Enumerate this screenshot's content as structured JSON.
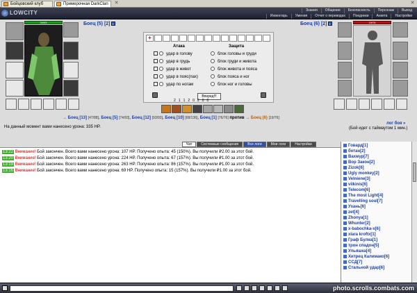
{
  "tabs": [
    {
      "label": "Бойцовский клуб"
    },
    {
      "label": "Примерочная DarkClan"
    }
  ],
  "header": {
    "logo": "LOWCITY",
    "nav_top": [
      "Знания",
      "Общение",
      "Безопасность",
      "Персонаж",
      "Выход"
    ],
    "nav_bottom": [
      "Инвентарь",
      "Умения",
      "Отчет о переводах",
      "Поединки",
      "Анкета",
      "Настройки"
    ]
  },
  "left_fighter": {
    "name": "Боец (5) [2]",
    "hp": "34/93"
  },
  "right_fighter": {
    "name": "Боец (6) [2]",
    "hp": "19/76"
  },
  "panel": {
    "attack_title": "Атака",
    "defense_title": "Защита",
    "attack": [
      "удар в голову",
      "удар в грудь",
      "удар в живот",
      "удар в пояс(пах)",
      "удар по ногам"
    ],
    "defense": [
      "блок головы и груди",
      "блок груди и живота",
      "блок живота и пояса",
      "блок пояса и ног",
      "блок ног и головы"
    ],
    "go_button": "Вперед!!!",
    "counts": [
      "2",
      "1",
      "1",
      "2",
      "0",
      "2",
      "0",
      "0"
    ]
  },
  "battle_row": {
    "team_left": [
      {
        "name": "Боец [13]",
        "hp": "[47/88]"
      },
      {
        "name": "Боец [5]",
        "hp": "[74/93]"
      },
      {
        "name": "Боец [12]",
        "hp": "[93/93]"
      },
      {
        "name": "Боец [10]",
        "hp": "[68/136]"
      },
      {
        "name": "Боец [1]",
        "hp": "[76/76]"
      }
    ],
    "vs": "против",
    "team_right": [
      {
        "name": "Боец (6)",
        "hp": "[19/76]"
      }
    ],
    "log_link": "лог боя »",
    "damage_text": "На данный момент вами нанесено урона: 335 HP.",
    "timeout": "(Бой идет с таймаутом 1 мин.)"
  },
  "chat_tabs": [
    "Чат",
    "Системные сообщения",
    "Все логи",
    "Мои логи",
    "Настройки"
  ],
  "messages": [
    {
      "time": "13:22",
      "warn": "Внимание!",
      "text": "Бой закончен. Всего вами нанесено урона: 107 HP. Получено опыта: 45 (150%). Вы получили ₽2.00 за этот бой."
    },
    {
      "time": "13:20",
      "warn": "Внимание!",
      "text": "Бой закончен. Всего вами нанесено урона: 224 HP. Получено опыта: 67 (157%). Вы получили ₽1.00 за этот бой."
    },
    {
      "time": "13:19",
      "warn": "Внимание!",
      "text": "Бой закончен. Всего вами нанесено урона: 263 HP. Получено опыта: 86 (157%). Вы получили ₽1.00 за этот бой."
    },
    {
      "time": "13:16",
      "warn": "Внимание!",
      "text": "Бой закончен. Всего вами нанесено урона: 69 HP. Получено опыта: 15 (157%). Вы получили ₽1.00 за этот бой."
    }
  ],
  "online": [
    "Говард[1]",
    "ботан[2]",
    "Вахмур[7]",
    "Вор Закон[2]",
    "Zizok[6]",
    "Ugly monkey[2]",
    "Velniene[3]",
    "vilkinis[6]",
    "Telecom[6]",
    "The most Light[4]",
    "Travelling soul[7]",
    "Ухань[6]",
    "zet[4]",
    "Zhonya[1]",
    "Whunter[2]",
    "x-babochka-x[6]",
    "xlara kroftx[1]",
    "Граф Булка[1]",
    "трон спадон[5]",
    "Ульяшка[4]",
    "Хитрец Калимако[6]",
    "ССД[7]",
    "Стальной удар[6]"
  ],
  "watermark": "photo.scrolls.combats.com"
}
